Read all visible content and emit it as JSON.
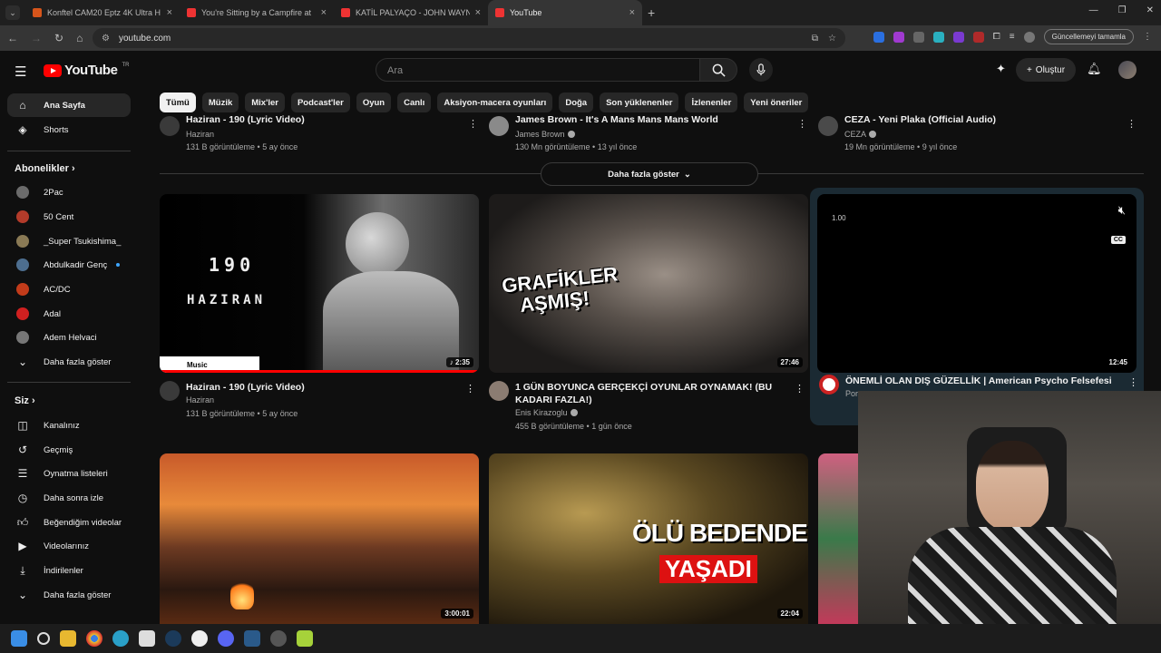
{
  "browser": {
    "tabs": [
      {
        "label": "Konftel CAM20 Eptz 4K Ultra H",
        "favicon": "nd-icon"
      },
      {
        "label": "You're Sitting by a Campfire at",
        "favicon": "youtube-icon"
      },
      {
        "label": "KATİL PALYAÇO - JOHN WAYNE",
        "favicon": "youtube-icon"
      },
      {
        "label": "YouTube",
        "favicon": "youtube-icon"
      }
    ],
    "url": "youtube.com",
    "update_label": "Güncellemeyi tamamla"
  },
  "header": {
    "logo_text": "YouTube",
    "logo_region": "TR",
    "search_placeholder": "Ara",
    "create_label": "Oluştur"
  },
  "sidebar": {
    "main": [
      {
        "label": "Ana Sayfa",
        "icon": "home-icon"
      },
      {
        "label": "Shorts",
        "icon": "shorts-icon"
      }
    ],
    "subscriptions_heading": "Abonelikler",
    "subscriptions": [
      {
        "label": "2Pac",
        "color": "#6b6b6b"
      },
      {
        "label": "50 Cent",
        "color": "#b33b2a"
      },
      {
        "label": "_Super Tsukishima_",
        "color": "#8a7a55"
      },
      {
        "label": "Abdulkadir Genç",
        "color": "#4d6e8f"
      },
      {
        "label": "AC/DC",
        "color": "#c23b1a"
      },
      {
        "label": "Adal",
        "color": "#d02020"
      },
      {
        "label": "Adem Helvaci",
        "color": "#777"
      }
    ],
    "subs_more": "Daha fazla göster",
    "you_heading": "Siz",
    "you": [
      {
        "label": "Kanalınız",
        "icon": "channel-icon"
      },
      {
        "label": "Geçmiş",
        "icon": "history-icon"
      },
      {
        "label": "Oynatma listeleri",
        "icon": "playlist-icon"
      },
      {
        "label": "Daha sonra izle",
        "icon": "clock-icon"
      },
      {
        "label": "Beğendiğim videolar",
        "icon": "like-icon"
      },
      {
        "label": "Videolarınız",
        "icon": "video-icon"
      },
      {
        "label": "İndirilenler",
        "icon": "download-icon"
      },
      {
        "label": "Daha fazla göster",
        "icon": "chevron-down-icon"
      }
    ]
  },
  "chips": [
    "Tümü",
    "Müzik",
    "Mix'ler",
    "Podcast'ler",
    "Oyun",
    "Canlı",
    "Aksiyon-macera oyunları",
    "Doğa",
    "Son yüklenenler",
    "İzlenenler",
    "Yeni öneriler"
  ],
  "previous_row": [
    {
      "title": "Haziran - 190 (Lyric Video)",
      "channel": "Haziran",
      "meta": "131 B görüntüleme • 5 ay önce"
    },
    {
      "title": "James Brown - It's A Mans Mans Mans World",
      "channel": "James Brown",
      "meta": "130 Mn görüntüleme • 13 yıl önce"
    },
    {
      "title": "CEZA - Yeni Plaka (Official Audio)",
      "channel": "CEZA",
      "meta": "19 Mn görüntüleme • 9 yıl önce"
    }
  ],
  "show_more_label": "Daha fazla göster",
  "videos": [
    {
      "title": "Haziran - 190 (Lyric Video)",
      "channel": "Haziran",
      "meta": "131 B görüntüleme • 5 ay önce",
      "duration": "2:35",
      "thumb_text_1": "190",
      "thumb_text_2": "HAZIRAN",
      "thumb_badge": "Music",
      "progress": 1.0
    },
    {
      "title": "1 GÜN BOYUNCA GERÇEKÇİ OYUNLAR OYNAMAK! (BU KADARI FAZLA!)",
      "channel": "Enis Kirazoglu",
      "meta": "455 B görüntüleme • 1 gün önce",
      "duration": "27:46",
      "thumb_text_1": "GRAFİKLER",
      "thumb_text_2": "AŞMIŞ!"
    },
    {
      "title": "ÖNEMLİ OLAN DIŞ GÜZELLİK | American Psycho Felsefesi",
      "channel": "Por",
      "duration": "12:45",
      "player_time": "1.00",
      "cc_label": "CC"
    },
    {
      "duration": "3:00:01"
    },
    {
      "duration": "22:04",
      "thumb_text_1": "ÖLÜ BEDENDE",
      "thumb_text_2": "YAŞADI"
    }
  ]
}
